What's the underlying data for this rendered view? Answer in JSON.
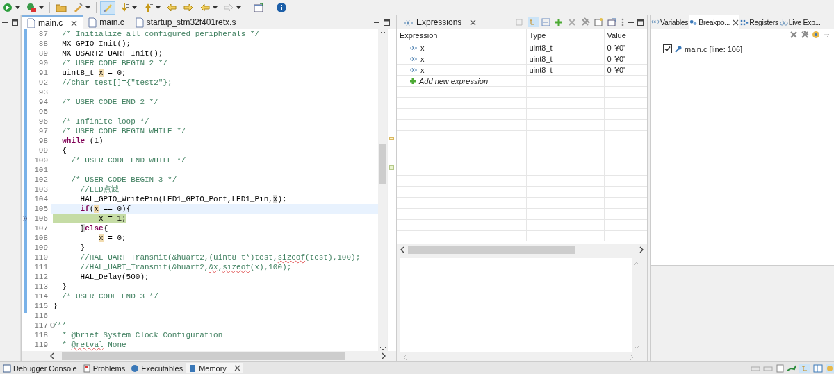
{
  "toolbar": {
    "buttons": [
      {
        "pressed": false,
        "dropdown": true
      },
      {
        "pressed": false,
        "dropdown": true
      },
      {
        "pressed": false,
        "dropdown": false
      },
      {
        "pressed": false,
        "dropdown": true
      },
      {
        "pressed": true,
        "dropdown": false
      },
      {
        "pressed": false,
        "dropdown": true
      },
      {
        "pressed": false,
        "dropdown": true
      },
      {
        "pressed": false,
        "dropdown": false
      },
      {
        "pressed": false,
        "dropdown": false
      },
      {
        "pressed": false,
        "dropdown": true
      },
      {
        "pressed": false,
        "dropdown": true
      },
      {
        "pressed": false,
        "dropdown": false
      },
      {
        "pressed": false,
        "dropdown": false
      }
    ]
  },
  "editor": {
    "tabs": [
      {
        "label": "main.c",
        "selected": true
      },
      {
        "label": "main.c",
        "selected": false
      },
      {
        "label": "startup_stm32f401retx.s",
        "selected": false
      }
    ],
    "lines": [
      {
        "num": "87",
        "segments": [
          {
            "text": "  /* Initialize all configured peripherals */",
            "kind": "comment"
          }
        ]
      },
      {
        "num": "88",
        "segments": [
          {
            "text": "  MX_GPIO_Init();",
            "kind": "plain"
          }
        ]
      },
      {
        "num": "89",
        "segments": [
          {
            "text": "  MX_USART2_UART_Init();",
            "kind": "plain"
          }
        ]
      },
      {
        "num": "90",
        "segments": [
          {
            "text": "  /* USER CODE BEGIN 2 */",
            "kind": "comment"
          }
        ]
      },
      {
        "num": "91",
        "segments": [
          {
            "text": "  uint8_t ",
            "kind": "plain"
          },
          {
            "text": "x",
            "kind": "mark"
          },
          {
            "text": " = 0;",
            "kind": "plain"
          }
        ]
      },
      {
        "num": "92",
        "segments": [
          {
            "text": "  //char test[]={\"test2\"};",
            "kind": "comment"
          }
        ]
      },
      {
        "num": "93"
      },
      {
        "num": "94",
        "segments": [
          {
            "text": "  /* USER CODE END 2 */",
            "kind": "comment"
          }
        ]
      },
      {
        "num": "95"
      },
      {
        "num": "96",
        "segments": [
          {
            "text": "  /* Infinite loop */",
            "kind": "comment"
          }
        ]
      },
      {
        "num": "97",
        "segments": [
          {
            "text": "  /* USER CODE BEGIN WHILE */",
            "kind": "comment"
          }
        ]
      },
      {
        "num": "98",
        "segments": [
          {
            "text": "  while",
            "kind": "keyword"
          },
          {
            "text": " (1)",
            "kind": "plain"
          }
        ]
      },
      {
        "num": "99",
        "segments": [
          {
            "text": "  {",
            "kind": "plain"
          }
        ]
      },
      {
        "num": "100",
        "segments": [
          {
            "text": "    /* USER CODE END WHILE */",
            "kind": "comment"
          }
        ]
      },
      {
        "num": "101"
      },
      {
        "num": "102",
        "segments": [
          {
            "text": "    /* USER CODE BEGIN 3 */",
            "kind": "comment"
          }
        ]
      },
      {
        "num": "103",
        "segments": [
          {
            "text": "      //LED点滅",
            "kind": "comment"
          }
        ]
      },
      {
        "num": "104",
        "segments": [
          {
            "text": "      HAL_GPIO_WritePin(LED1_GPIO_Port,LED1_Pin,",
            "kind": "plain"
          },
          {
            "text": "x",
            "kind": "match"
          },
          {
            "text": ");",
            "kind": "plain"
          }
        ]
      },
      {
        "num": "105",
        "current": true,
        "segments": [
          {
            "text": "      if",
            "kind": "keyword"
          },
          {
            "text": "(",
            "kind": "plain"
          },
          {
            "text": "x",
            "kind": "mark"
          },
          {
            "text": " == 0){",
            "kind": "plain"
          }
        ]
      },
      {
        "num": "106",
        "debug": true,
        "segments": [
          {
            "text": "          x = 1;",
            "kind": "plain"
          }
        ]
      },
      {
        "num": "107",
        "segments": [
          {
            "text": "      }",
            "kind": "match"
          },
          {
            "text": "else",
            "kind": "keyword"
          },
          {
            "text": "{",
            "kind": "plain"
          }
        ]
      },
      {
        "num": "108",
        "segments": [
          {
            "text": "          x",
            "kind": "mark"
          },
          {
            "text": " = 0;",
            "kind": "plain"
          }
        ]
      },
      {
        "num": "109",
        "segments": [
          {
            "text": "      }",
            "kind": "plain"
          }
        ]
      },
      {
        "num": "110",
        "segments": [
          {
            "text": "      //HAL_UART_Transmit(&huart2,(uint8_t*)test,",
            "kind": "comment"
          },
          {
            "text": "sizeof",
            "kind": "squiggle"
          },
          {
            "text": "(test),100);",
            "kind": "comment"
          }
        ]
      },
      {
        "num": "111",
        "segments": [
          {
            "text": "      //HAL_UART_Transmit(&huart2,",
            "kind": "comment"
          },
          {
            "text": "&x",
            "kind": "squiggle"
          },
          {
            "text": ",",
            "kind": "comment"
          },
          {
            "text": "sizeof",
            "kind": "squiggle"
          },
          {
            "text": "(x),100);",
            "kind": "comment"
          }
        ]
      },
      {
        "num": "112",
        "segments": [
          {
            "text": "      HAL_Delay(500);",
            "kind": "plain"
          }
        ]
      },
      {
        "num": "113",
        "segments": [
          {
            "text": "  }",
            "kind": "plain"
          }
        ]
      },
      {
        "num": "114",
        "segments": [
          {
            "text": "  /* USER CODE END 3 */",
            "kind": "comment"
          }
        ]
      },
      {
        "num": "115",
        "segments": [
          {
            "text": "}",
            "kind": "plain"
          }
        ]
      },
      {
        "num": "116"
      },
      {
        "num": "117",
        "folded": false,
        "segments": [
          {
            "text": "/**",
            "kind": "comment"
          }
        ]
      },
      {
        "num": "118",
        "segments": [
          {
            "text": "  * @brief System Clock Configuration",
            "kind": "comment"
          }
        ]
      },
      {
        "num": "119",
        "segments": [
          {
            "text": "  * ",
            "kind": "comment"
          },
          {
            "text": "@retval",
            "kind": "squiggle"
          },
          {
            "text": " None",
            "kind": "comment"
          }
        ]
      }
    ]
  },
  "expressions": {
    "tab": {
      "label": "Expressions",
      "selected": true
    },
    "columns": [
      "Expression",
      "Type",
      "Value"
    ],
    "rows": [
      {
        "expression": "x",
        "type": "uint8_t",
        "value": "0 '¥0'"
      },
      {
        "expression": "x",
        "type": "uint8_t",
        "value": "0 '¥0'"
      },
      {
        "expression": "x",
        "type": "uint8_t",
        "value": "0 '¥0'"
      }
    ],
    "add_label": "Add new expression"
  },
  "right_panel": {
    "tabs": [
      {
        "label": "Variables",
        "selected": false
      },
      {
        "label": "Breakpo...",
        "selected": true
      },
      {
        "label": "Registers",
        "selected": false
      },
      {
        "label": "Live Exp...",
        "selected": false
      }
    ],
    "breakpoints": [
      {
        "label": "main.c [line: 106]",
        "checked": true
      }
    ]
  },
  "bottom_tabs": [
    {
      "label": "Debugger Console",
      "selected": false
    },
    {
      "label": "Problems",
      "selected": false
    },
    {
      "label": "Executables",
      "selected": false
    },
    {
      "label": "Memory",
      "selected": true
    }
  ]
}
